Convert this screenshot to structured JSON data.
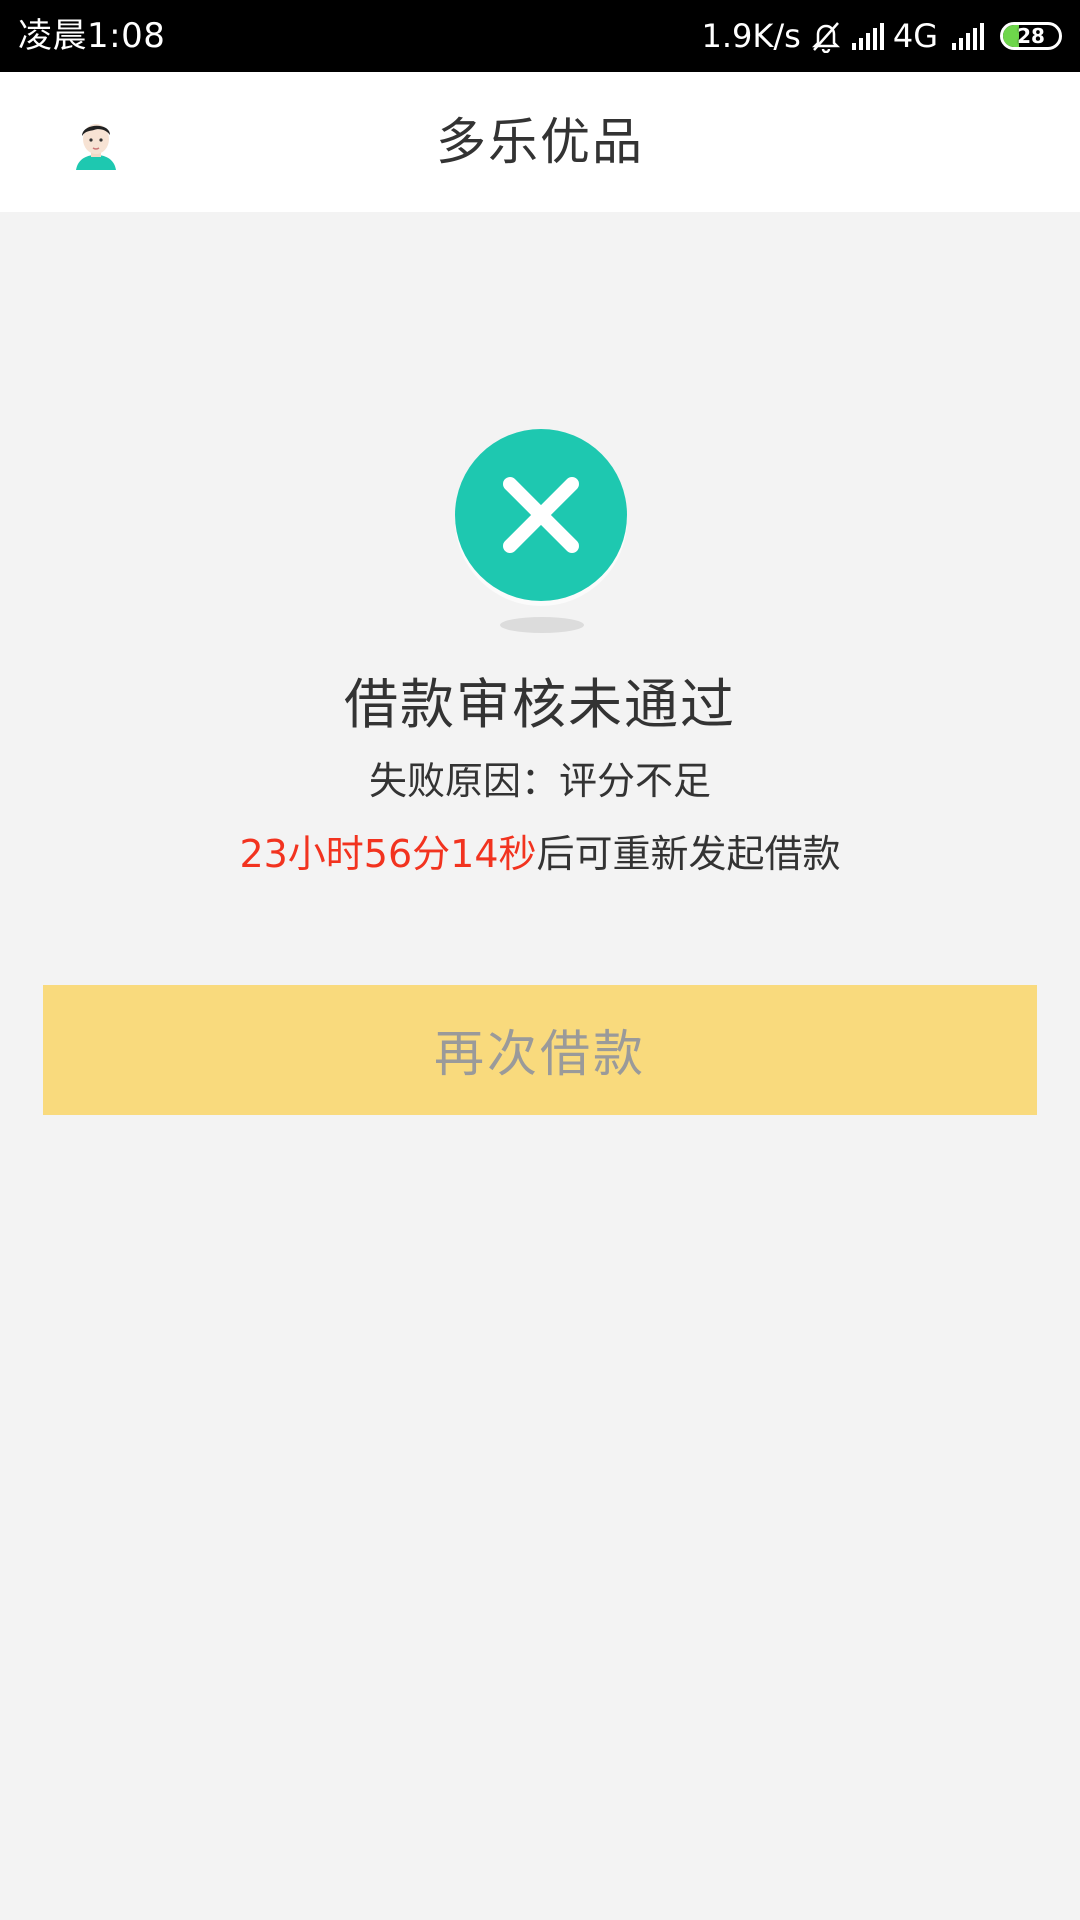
{
  "status_bar": {
    "time": "凌晨1:08",
    "network_speed": "1.9K/s",
    "network_type": "4G",
    "battery_level": "28",
    "battery_fraction": 0.28,
    "icons": [
      "bell-muted-icon",
      "signal-icon",
      "signal-icon-2",
      "battery-icon"
    ]
  },
  "header": {
    "title": "多乐优品",
    "avatar_icon": "user-avatar-icon"
  },
  "result": {
    "icon": "fail-x-icon",
    "icon_color": "#1ec8b0",
    "title": "借款审核未通过",
    "reason": "失败原因：评分不足",
    "countdown": "23小时56分14秒",
    "countdown_suffix": "后可重新发起借款",
    "countdown_color": "#f2331f"
  },
  "button": {
    "label": "再次借款",
    "background": "#f9da7d"
  }
}
